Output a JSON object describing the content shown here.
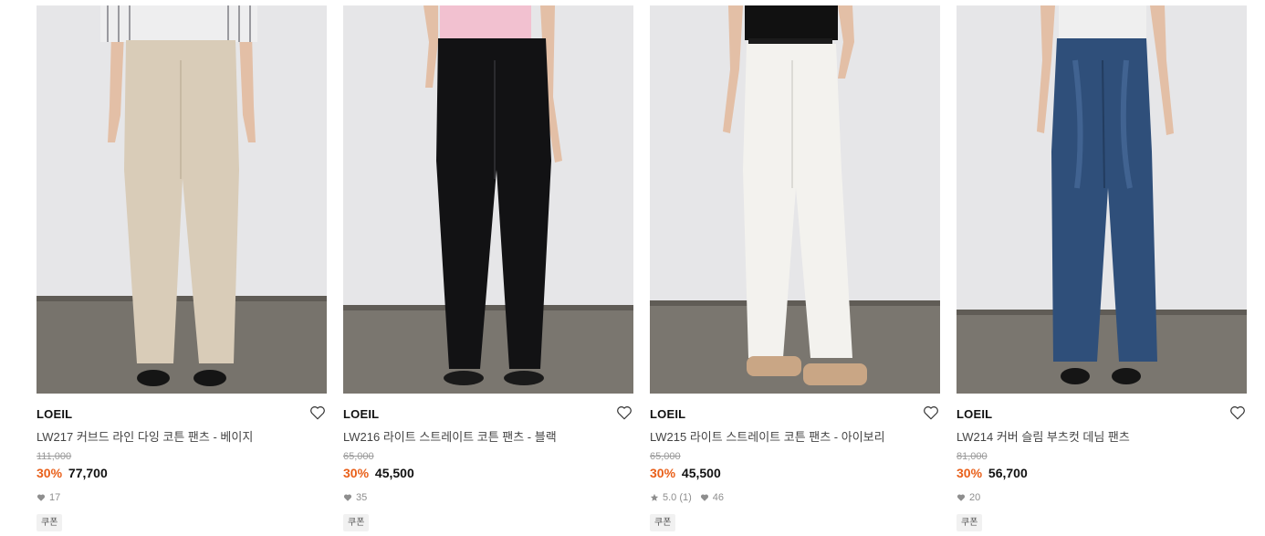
{
  "products": [
    {
      "brand": "LOEIL",
      "name": "LW217 커브드 라인 다잉 코튼 팬츠 - 베이지",
      "original_price": "111,000",
      "discount": "30%",
      "price": "77,700",
      "rating": null,
      "likes": "17",
      "coupon": "쿠폰",
      "pant_color": "#d9ccb8",
      "top_color": "#e8e8ea"
    },
    {
      "brand": "LOEIL",
      "name": "LW216 라이트 스트레이트 코튼 팬츠 - 블랙",
      "original_price": "65,000",
      "discount": "30%",
      "price": "45,500",
      "rating": null,
      "likes": "35",
      "coupon": "쿠폰",
      "pant_color": "#121214",
      "top_color": "#f2c1d0"
    },
    {
      "brand": "LOEIL",
      "name": "LW215 라이트 스트레이트 코튼 팬츠 - 아이보리",
      "original_price": "65,000",
      "discount": "30%",
      "price": "45,500",
      "rating": "5.0 (1)",
      "likes": "46",
      "coupon": "쿠폰",
      "pant_color": "#f3f2ee",
      "top_color": "#111111"
    },
    {
      "brand": "LOEIL",
      "name": "LW214 커버 슬림 부츠컷 데님 팬츠",
      "original_price": "81,000",
      "discount": "30%",
      "price": "56,700",
      "rating": null,
      "likes": "20",
      "coupon": "쿠폰",
      "pant_color": "#2f4f7a",
      "top_color": "#efefef"
    }
  ],
  "icons": {
    "wishlist": "heart-outline-icon",
    "likes": "heart-filled-icon",
    "rating": "star-icon"
  },
  "colors": {
    "discount": "#e9601a",
    "wall": "#e6e6e8",
    "floor": "#77736c",
    "skin": "#e3bfa6"
  }
}
